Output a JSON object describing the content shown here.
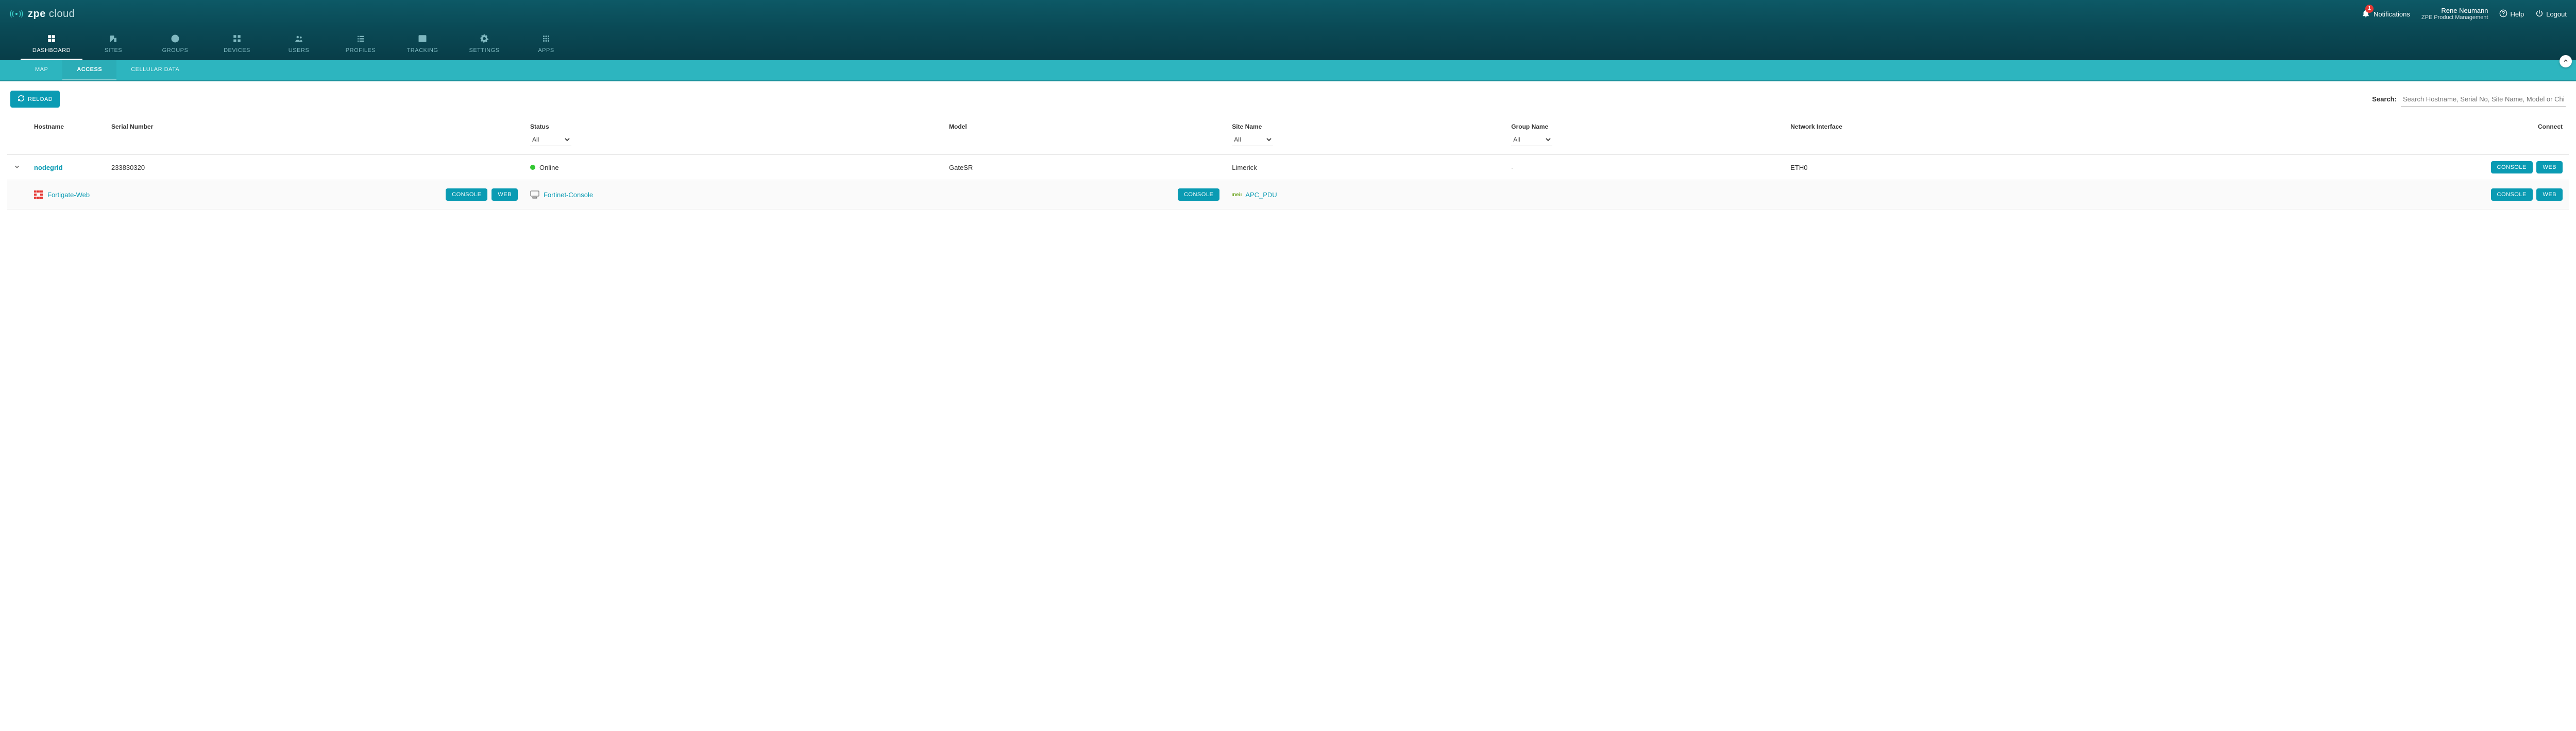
{
  "brand": {
    "name": "zpe",
    "suffix": "cloud"
  },
  "header": {
    "notifications_label": "Notifications",
    "notifications_count": "1",
    "user_name": "Rene Neumann",
    "user_org": "ZPE Product Management",
    "help_label": "Help",
    "logout_label": "Logout"
  },
  "nav": {
    "items": [
      {
        "label": "DASHBOARD"
      },
      {
        "label": "SITES"
      },
      {
        "label": "GROUPS"
      },
      {
        "label": "DEVICES"
      },
      {
        "label": "USERS"
      },
      {
        "label": "PROFILES"
      },
      {
        "label": "TRACKING"
      },
      {
        "label": "SETTINGS"
      },
      {
        "label": "APPS"
      }
    ]
  },
  "subnav": {
    "items": [
      {
        "label": "MAP"
      },
      {
        "label": "ACCESS"
      },
      {
        "label": "CELLULAR DATA"
      }
    ]
  },
  "toolbar": {
    "reload_label": "RELOAD",
    "search_label": "Search:",
    "search_placeholder": "Search Hostname, Serial No, Site Name, Model or Child device"
  },
  "columns": {
    "hostname": "Hostname",
    "serial": "Serial Number",
    "status": "Status",
    "model": "Model",
    "site": "Site Name",
    "group": "Group Name",
    "netif": "Network Interface",
    "connect": "Connect",
    "filter_all": "All"
  },
  "rows": [
    {
      "hostname": "nodegrid",
      "serial": "233830320",
      "status_text": "Online",
      "model": "GateSR",
      "site": "Limerick",
      "group": "-",
      "netif": "ETH0",
      "buttons": {
        "console": "CONSOLE",
        "web": "WEB"
      }
    }
  ],
  "children": [
    {
      "name": "Fortigate-Web",
      "buttons": {
        "console": "CONSOLE",
        "web": "WEB"
      }
    },
    {
      "name": "Fortinet-Console",
      "buttons": {
        "console": "CONSOLE"
      }
    },
    {
      "name": "APC_PDU",
      "buttons": {
        "console": "CONSOLE",
        "web": "WEB"
      }
    }
  ]
}
